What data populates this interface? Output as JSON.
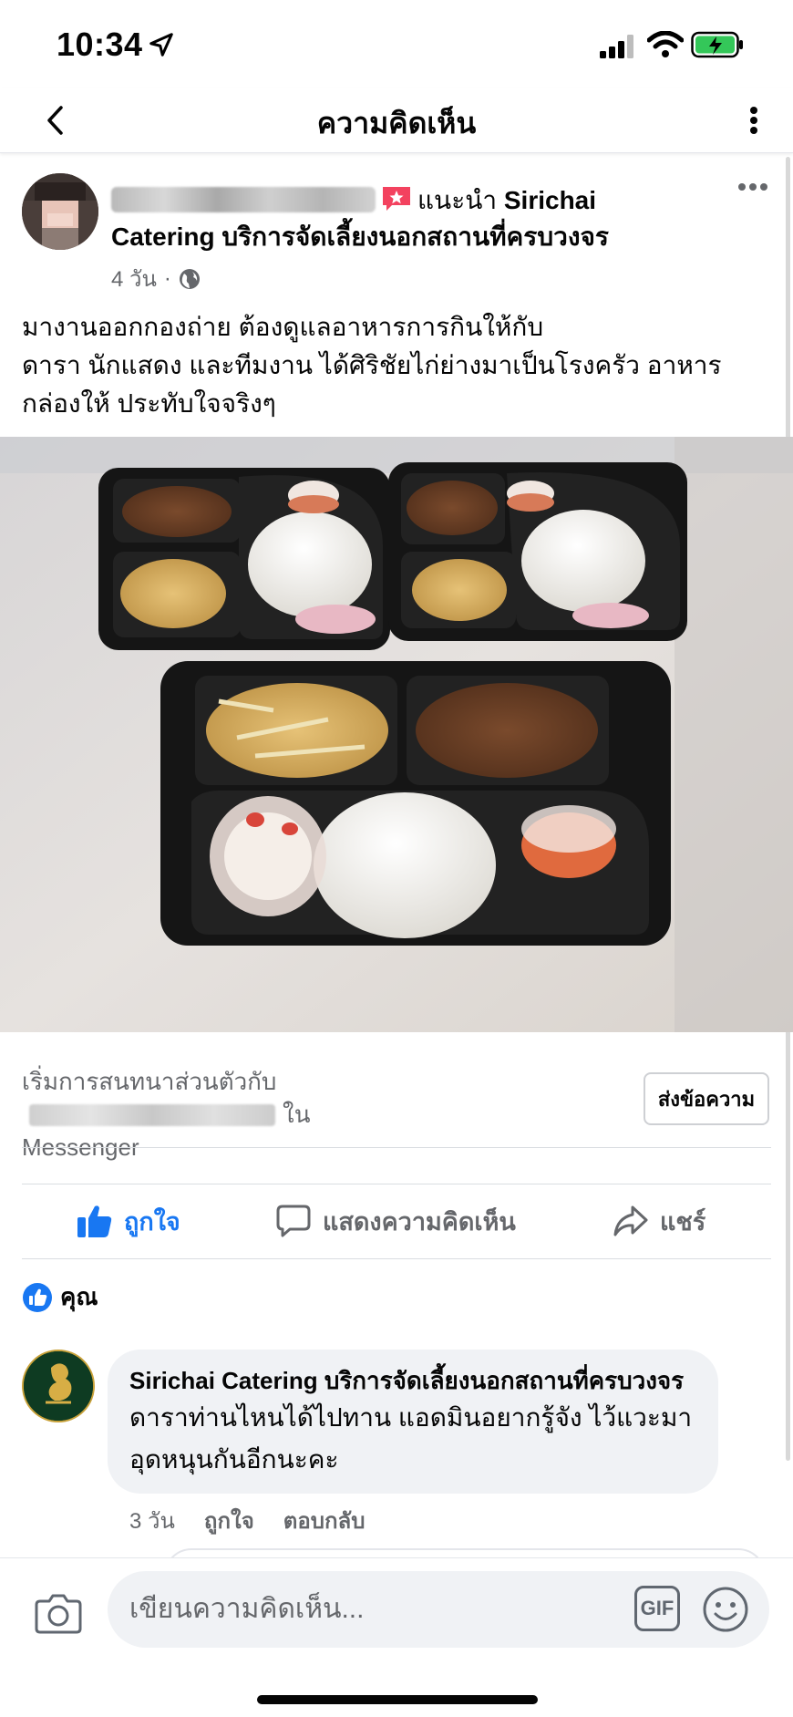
{
  "status_bar": {
    "time": "10:34",
    "icons": [
      "location-arrow-icon",
      "signal-icon",
      "wifi-icon",
      "battery-charging-icon"
    ],
    "battery_color": "#34c759"
  },
  "header": {
    "title": "ความคิดเห็น",
    "back_icon": "chevron-left-icon",
    "more_icon": "more-vertical-icon"
  },
  "post": {
    "recommends_label": "แนะนำ",
    "page_name": "Sirichai Catering บริการจัดเลี้ยงนอกสถานที่ครบวงจร",
    "time": "4 วัน",
    "privacy_icon": "globe-icon",
    "text_lines": [
      "มางานออกกองถ่าย ต้องดูแลอาหารการกินให้กับ",
      "ดารา นักแสดง และทีมงาน ได้ศิริชัยไก่ย่างมาเป็นโรงครัว อาหาร",
      "กล่องให้ ประทับใจจริงๆ"
    ],
    "photo_alt": "food-boxes-photo"
  },
  "messenger_prompt": {
    "prefix": "เริ่มการสนทนาส่วนตัวกับ",
    "suffix": "ใน",
    "line2": "Messenger",
    "button": "ส่งข้อความ"
  },
  "actions": {
    "like": "ถูกใจ",
    "comment": "แสดงความคิดเห็น",
    "share": "แชร์"
  },
  "reactions": {
    "who": "คุณ"
  },
  "comment": {
    "author": "Sirichai Catering บริการจัดเลี้ยงนอกสถานที่ครบวงจร",
    "text_line1": "ดาราท่านไหนได้ไปทาน แอดมินอยากรู้จัง ไว้แวะมา",
    "text_line2": "อุดหนุนกันอีกนะคะ",
    "time": "3 วัน",
    "like": "ถูกใจ",
    "reply": "ตอบกลับ"
  },
  "composer": {
    "placeholder": "เขียนความคิดเห็น...",
    "gif_label": "GIF"
  },
  "colors": {
    "accent": "#1877f2",
    "secondary_text": "#65676b",
    "bubble": "#f0f2f5"
  }
}
